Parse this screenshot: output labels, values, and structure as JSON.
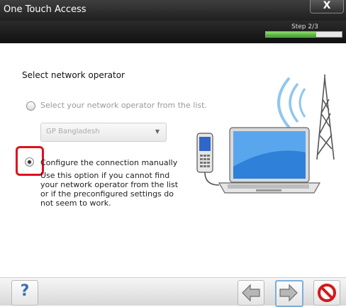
{
  "window": {
    "title": "One Touch Access",
    "close_label": "X"
  },
  "progress": {
    "step_text": "Step 2/3",
    "fraction": 0.667
  },
  "main": {
    "heading": "Select network operator",
    "option_list": {
      "label": "Select your network operator from the list.",
      "selected": false
    },
    "dropdown": {
      "selected_value": "GP Bangladesh"
    },
    "option_manual": {
      "label": "Configure the connection manually",
      "selected": true,
      "help_lines": [
        "Use this option if you cannot find",
        "your network operator from the list",
        "or if the preconfigured settings do",
        "not seem to work."
      ]
    }
  },
  "footer": {
    "help_label": "?"
  },
  "colors": {
    "highlight": "#e0101e",
    "accent": "#3c6fb4",
    "progress": "#3aa12a"
  }
}
